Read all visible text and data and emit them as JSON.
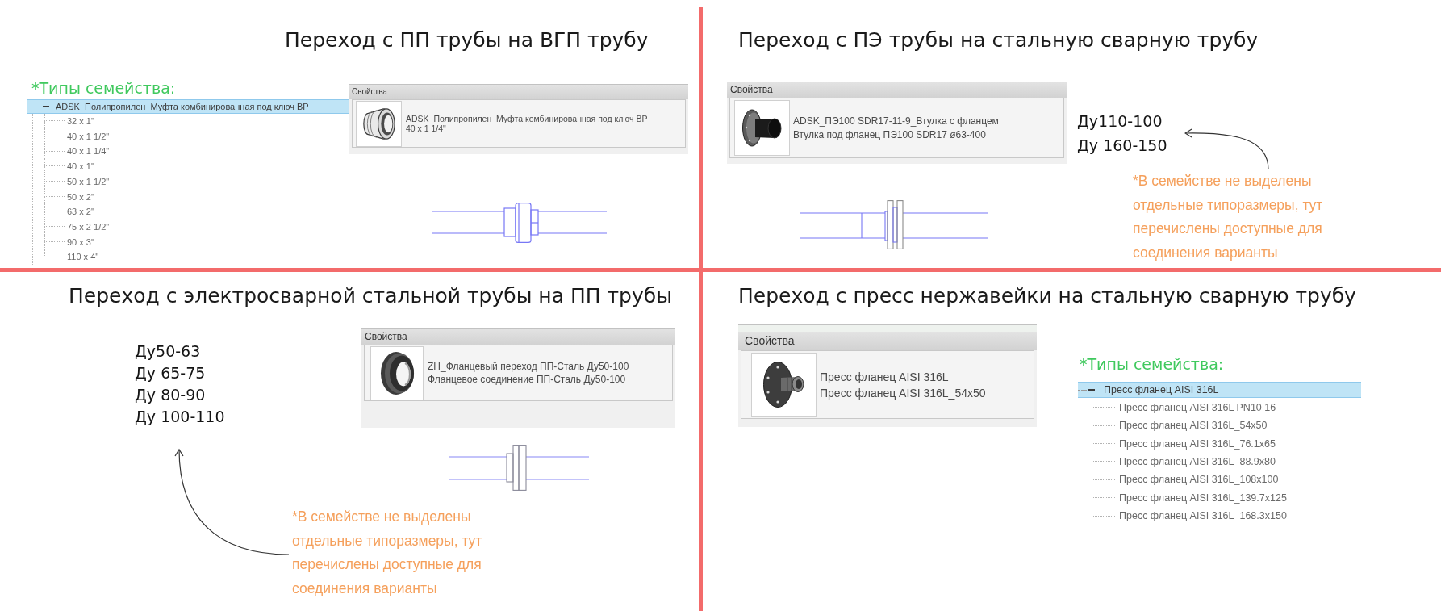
{
  "top_left": {
    "title": "Переход с ПП трубы на ВГП трубу",
    "family_types": {
      "heading": "*Типы семейства:",
      "tree": {
        "label": "ADSK_Полипропилен_Муфта комбинированная под ключ ВР",
        "expanded": true,
        "selected": true,
        "children": [
          {
            "label": "32 x 1\"",
            "selected": false
          },
          {
            "label": "40 x 1 1/2\"",
            "selected": false
          },
          {
            "label": "40 x 1 1/4\"",
            "selected": false
          },
          {
            "label": "40 x 1\"",
            "selected": false
          },
          {
            "label": "50 x 1 1/2\"",
            "selected": false
          },
          {
            "label": "50 x 2\"",
            "selected": false
          },
          {
            "label": "63 x 2\"",
            "selected": false
          },
          {
            "label": "75 x 2 1/2\"",
            "selected": false
          },
          {
            "label": "90 x 3\"",
            "selected": false
          },
          {
            "label": "110 x 4\"",
            "selected": false
          }
        ]
      }
    },
    "properties": {
      "header": "Свойства",
      "family": "ADSK_Полипропилен_Муфта комбинированная под ключ ВР",
      "type": "40 x 1 1/4\""
    }
  },
  "top_right": {
    "title": "Переход с ПЭ трубы на стальную сварную трубу",
    "properties": {
      "header": "Свойства",
      "family": "ADSK_ПЭ100 SDR17-11-9_Втулка с фланцем",
      "type": "Втулка под фланец ПЭ100 SDR17 ø63-400"
    },
    "sizes": [
      "Ду110-100",
      "Ду 160-150"
    ],
    "note": "*В семействе не выделены\nотдельные типоразмеры, тут\nперечислены доступные для\nсоединения варианты"
  },
  "bottom_left": {
    "title": "Переход с электросварной стальной трубы на ПП трубы",
    "sizes": [
      "Ду50-63",
      "Ду 65-75",
      "Ду 80-90",
      "Ду 100-110"
    ],
    "properties": {
      "header": "Свойства",
      "family": "ZH_Фланцевый переход ПП-Сталь Ду50-100",
      "type": "Фланцевое соединение ПП-Сталь Ду50-100"
    },
    "note": "*В семействе не выделены\nотдельные типоразмеры, тут\nперечислены доступные для\nсоединения варианты"
  },
  "bottom_right": {
    "title": "Переход с пресс нержавейки на стальную сварную трубу",
    "properties": {
      "header": "Свойства",
      "family": "Пресс фланец AISI 316L",
      "type": "Пресс фланец AISI 316L_54x50"
    },
    "family_types": {
      "heading": "*Типы семейства:",
      "tree": {
        "label": "Пресс фланец AISI 316L",
        "expanded": true,
        "selected": true,
        "children": [
          {
            "label": "Пресс фланец AISI 316L PN10 16",
            "selected": false
          },
          {
            "label": "Пресс фланец AISI 316L_54x50",
            "selected": false
          },
          {
            "label": "Пресс фланец AISI 316L_76.1x65",
            "selected": false
          },
          {
            "label": "Пресс фланец AISI 316L_88.9x80",
            "selected": false
          },
          {
            "label": "Пресс фланец AISI 316L_108x100",
            "selected": false
          },
          {
            "label": "Пресс фланец AISI 316L_139.7x125",
            "selected": false
          },
          {
            "label": "Пресс фланец AISI 316L_168.3x150",
            "selected": false
          }
        ]
      }
    }
  }
}
